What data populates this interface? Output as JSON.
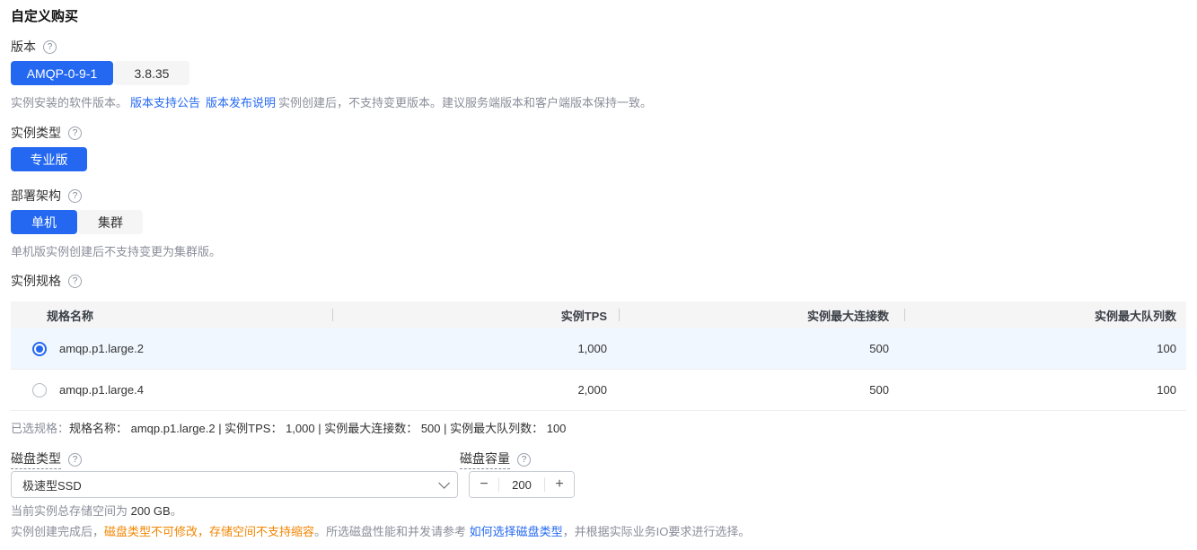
{
  "colors": {
    "accent": "#2468f2",
    "selected_row_bg": "#f0f7ff",
    "warning_text": "#f28500",
    "muted_text": "#8a8e99"
  },
  "page": {
    "title": "自定义购买"
  },
  "icons": {
    "help": "?"
  },
  "version": {
    "label": "版本",
    "options": [
      {
        "label": "AMQP-0-9-1",
        "selected": true
      },
      {
        "label": "3.8.35",
        "selected": false
      }
    ],
    "help_prefix": "实例安装的软件版本。",
    "link_bulletin": "版本支持公告",
    "link_release_notes": "版本发布说明",
    "help_suffix": "实例创建后，不支持变更版本。建议服务端版本和客户端版本保持一致。"
  },
  "instance_type": {
    "label": "实例类型",
    "options": [
      {
        "label": "专业版",
        "selected": true
      }
    ]
  },
  "architecture": {
    "label": "部署架构",
    "options": [
      {
        "label": "单机",
        "selected": true
      },
      {
        "label": "集群",
        "selected": false
      }
    ],
    "help": "单机版实例创建后不支持变更为集群版。"
  },
  "spec": {
    "label": "实例规格",
    "table": {
      "columns": [
        "规格名称",
        "实例TPS",
        "实例最大连接数",
        "实例最大队列数"
      ],
      "rows": [
        {
          "name": "amqp.p1.large.2",
          "tps": "1,000",
          "max_connections": "500",
          "max_queues": "100",
          "selected": true
        },
        {
          "name": "amqp.p1.large.4",
          "tps": "2,000",
          "max_connections": "500",
          "max_queues": "100",
          "selected": false
        }
      ]
    },
    "summary_label": "已选规格：",
    "summary_text": "规格名称： amqp.p1.large.2 | 实例TPS： 1,000 | 实例最大连接数： 500 | 实例最大队列数： 100"
  },
  "disk": {
    "type_label": "磁盘类型",
    "type_value": "极速型SSD",
    "capacity_label": "磁盘容量",
    "capacity_value": "200",
    "minus": "−",
    "plus": "+",
    "storage_note_prefix": "当前实例总存储空间为 ",
    "storage_note_value": "200 GB",
    "storage_note_suffix": "。",
    "note_prefix": "实例创建完成后，",
    "note_warning": "磁盘类型不可修改，存储空间不支持缩容",
    "note_mid": "。所选磁盘性能和并发请参考 ",
    "note_link": "如何选择磁盘类型",
    "note_suffix": "，并根据实际业务IO要求进行选择。"
  }
}
